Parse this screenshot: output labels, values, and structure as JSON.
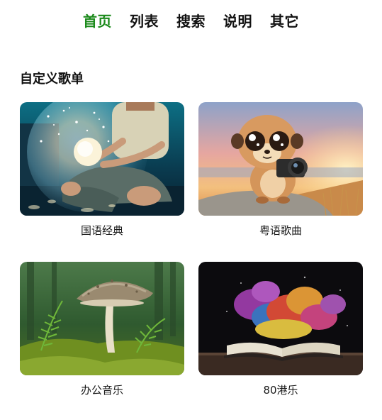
{
  "nav": {
    "items": [
      {
        "label": "首页",
        "active": true
      },
      {
        "label": "列表",
        "active": false
      },
      {
        "label": "搜索",
        "active": false
      },
      {
        "label": "说明",
        "active": false
      },
      {
        "label": "其它",
        "active": false
      }
    ]
  },
  "section": {
    "title": "自定义歌单"
  },
  "playlists": [
    {
      "name": "国语经典",
      "image": "child-holding-glowing-orb"
    },
    {
      "name": "粤语歌曲",
      "image": "cartoon-meerkat-with-camera-at-sunset"
    },
    {
      "name": "办公音乐",
      "image": "mushroom-and-ferns-in-forest"
    },
    {
      "name": "80港乐",
      "image": "open-book-with-colorful-smoke"
    }
  ],
  "colors": {
    "accent": "#1b8a1b",
    "text": "#111111",
    "background": "#ffffff"
  }
}
